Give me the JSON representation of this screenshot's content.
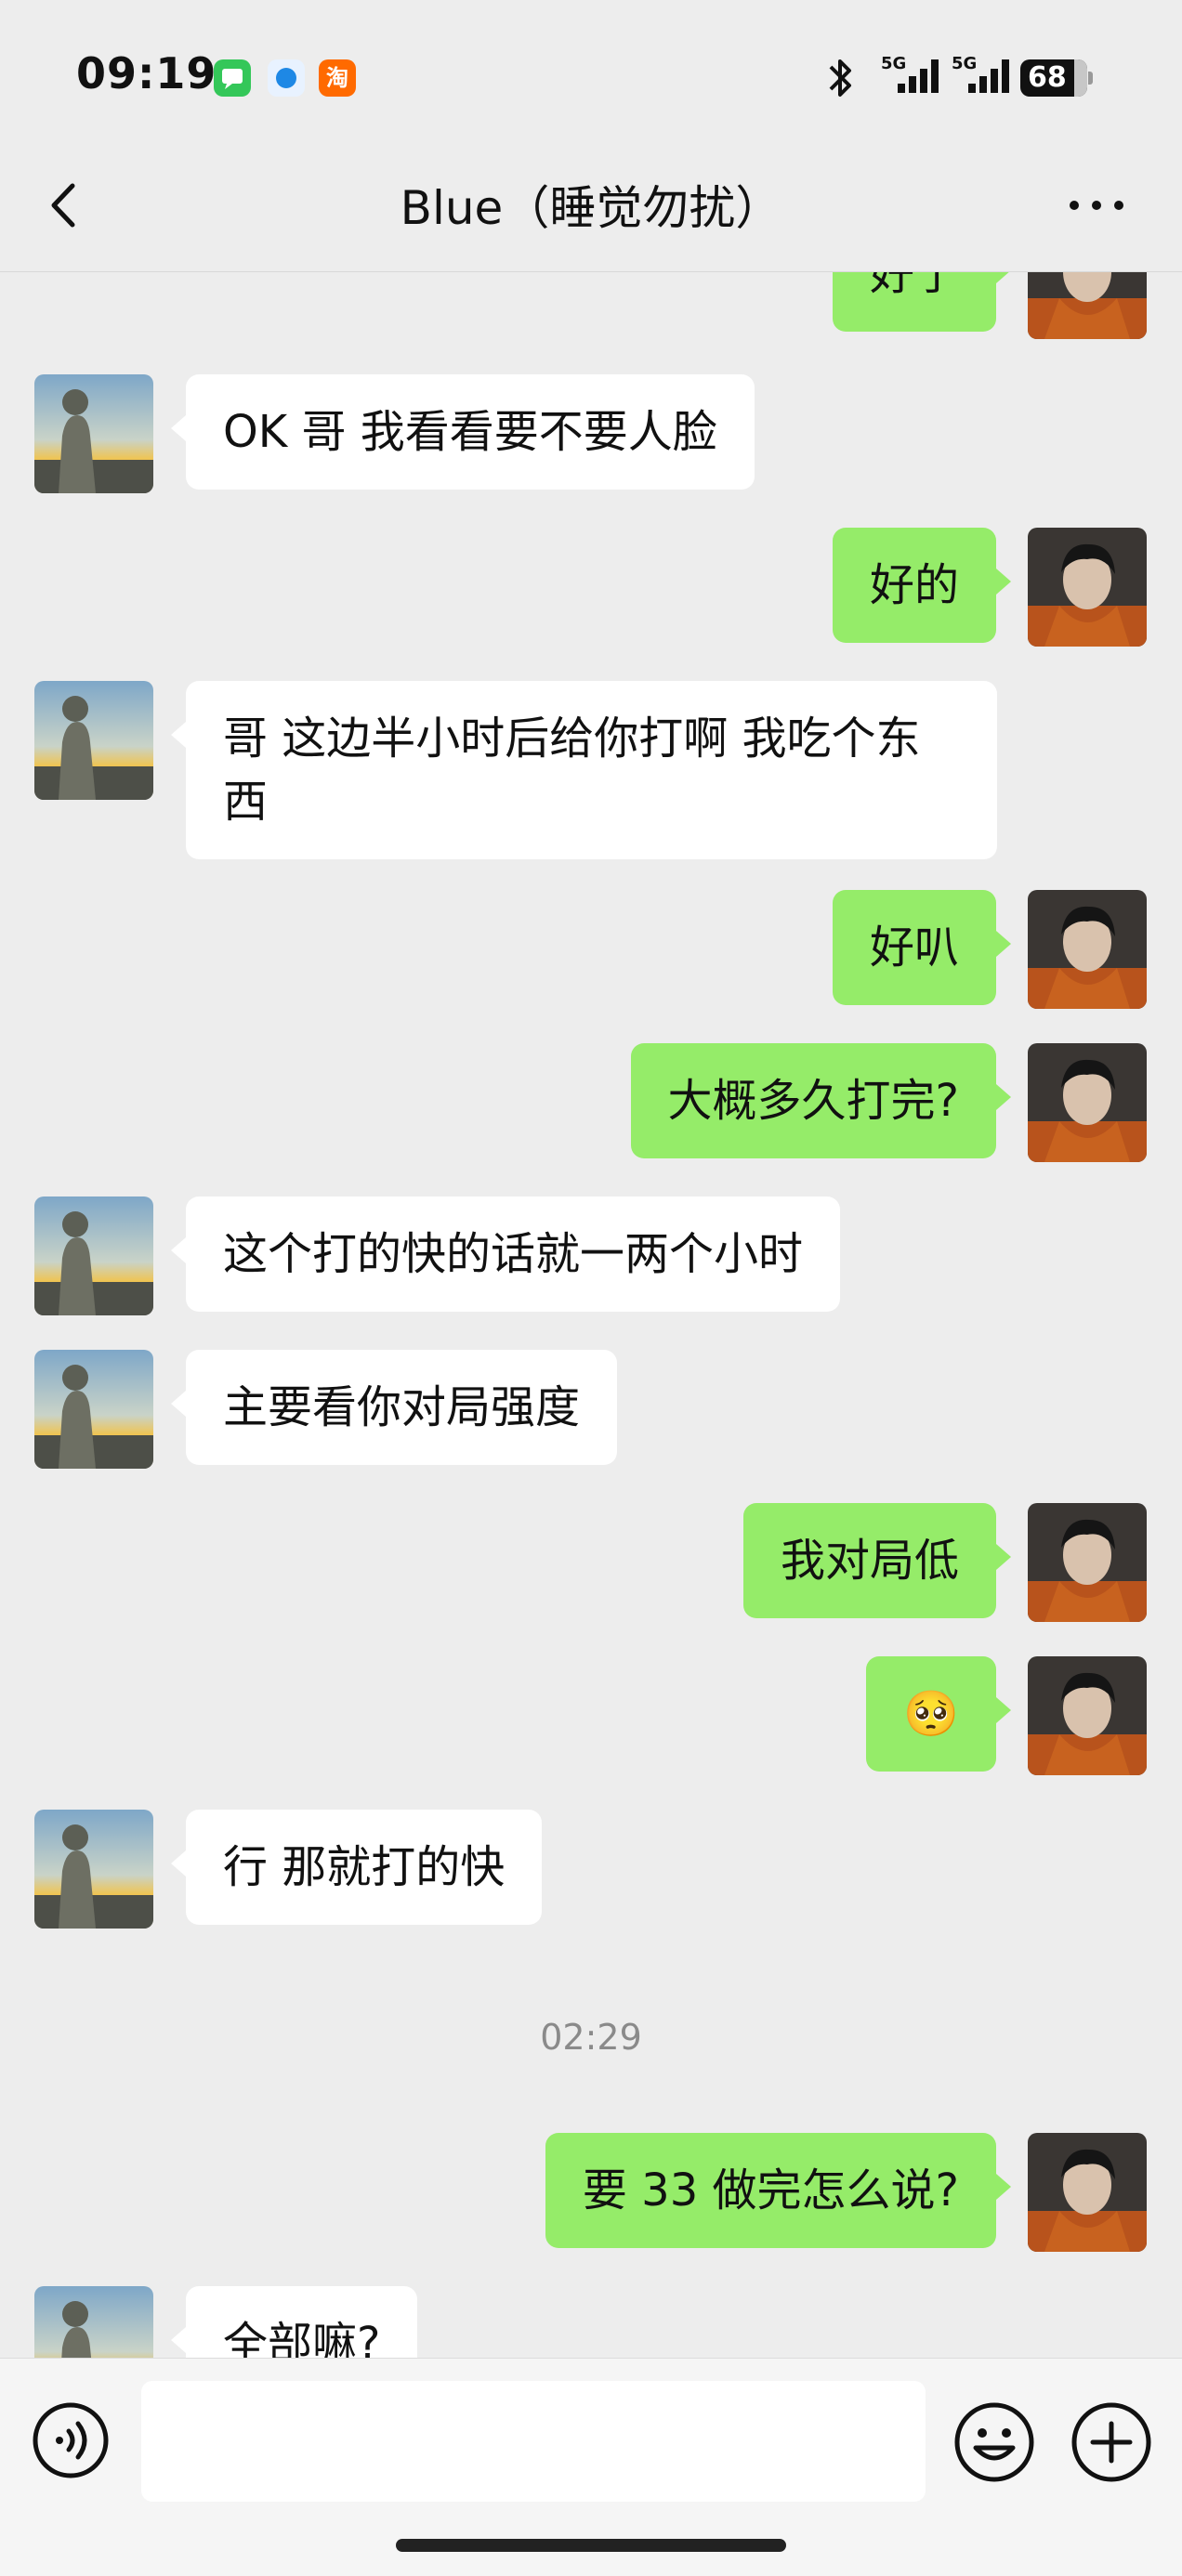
{
  "status_bar": {
    "time": "09:19",
    "app_icons": [
      "messages-icon",
      "compass-icon",
      "taobao-icon"
    ],
    "taobao_label": "淘",
    "network_1": "5G",
    "network_2": "5G",
    "battery": "68"
  },
  "header": {
    "title": "Blue（睡觉勿扰）"
  },
  "messages": [
    {
      "side": "out",
      "text": "好了"
    },
    {
      "side": "in",
      "text": "OK 哥 我看看要不要人脸"
    },
    {
      "side": "out",
      "text": "好的"
    },
    {
      "side": "in",
      "text": "哥 这边半小时后给你打啊 我吃个东西"
    },
    {
      "side": "out",
      "text": "好叭"
    },
    {
      "side": "out",
      "text": "大概多久打完?"
    },
    {
      "side": "in",
      "text": "这个打的快的话就一两个小时"
    },
    {
      "side": "in",
      "text": "主要看你对局强度"
    },
    {
      "side": "out",
      "text": "我对局低"
    },
    {
      "side": "out",
      "text": "🥺"
    },
    {
      "side": "in",
      "text": "行 那就打的快"
    },
    {
      "side": "out",
      "text": "要 33 做完怎么说?"
    },
    {
      "side": "in",
      "text": "全部嘛?"
    }
  ],
  "timestamp": "02:29",
  "colors": {
    "background": "#ededed",
    "outgoing_bubble": "#95ec69",
    "incoming_bubble": "#ffffff",
    "timestamp_text": "#8a8a8a"
  },
  "input_bar": {
    "icons": [
      "voice-icon",
      "emoji-icon",
      "plus-icon"
    ],
    "value": ""
  }
}
